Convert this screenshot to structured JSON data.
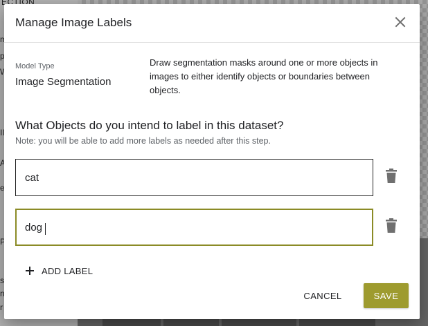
{
  "background": {
    "sidebar_fragments": [
      "ECTION",
      "m",
      "p",
      "W",
      "IN",
      "AC",
      "e",
      "P",
      "s",
      "n",
      "r"
    ]
  },
  "dialog": {
    "title": "Manage Image Labels",
    "close_icon": "close-icon",
    "model_type_label": "Model Type",
    "model_type_value": "Image Segmentation",
    "model_description": "Draw segmentation masks around one or more objects in images to either identify objects or boundaries between objects.",
    "question": "What Objects do you intend to label in this dataset?",
    "note": "Note: you will be able to add more labels as needed after this step.",
    "labels": [
      {
        "value": "cat",
        "delete_icon": "trash-icon"
      },
      {
        "value": "dog",
        "delete_icon": "trash-icon"
      }
    ],
    "add_label": {
      "icon": "plus-icon",
      "text": "ADD LABEL"
    },
    "cancel_label": "CANCEL",
    "save_label": "SAVE",
    "colors": {
      "accent": "#9e9b2f",
      "focus_border": "#8b8b26",
      "input_border": "#1f1f1f"
    }
  }
}
